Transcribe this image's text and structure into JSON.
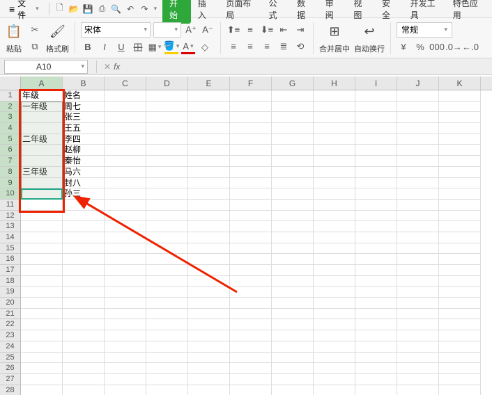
{
  "menu": {
    "file": "文件",
    "tabs": [
      "开始",
      "插入",
      "页面布局",
      "公式",
      "数据",
      "审阅",
      "视图",
      "安全",
      "开发工具",
      "特色应用"
    ],
    "active_tab_index": 0
  },
  "ribbon": {
    "paste": "粘贴",
    "format_painter": "格式刷",
    "font_name": "宋体",
    "font_size": "",
    "merge_center": "合并居中",
    "wrap_text": "自动换行",
    "number_format": "常规"
  },
  "formula": {
    "namebox": "A10",
    "fx": "fx",
    "value": ""
  },
  "columns": [
    "A",
    "B",
    "C",
    "D",
    "E",
    "F",
    "G",
    "H",
    "I",
    "J",
    "K"
  ],
  "row_count": 28,
  "chart_data": {
    "type": "table",
    "columns_visible": [
      "A",
      "B"
    ],
    "headers": {
      "A": "年级",
      "B": "姓名"
    },
    "rows": [
      {
        "A": "一年级",
        "B": "周七"
      },
      {
        "A": "",
        "B": "张三"
      },
      {
        "A": "",
        "B": "王五"
      },
      {
        "A": "二年级",
        "B": "李四"
      },
      {
        "A": "",
        "B": "赵柳"
      },
      {
        "A": "",
        "B": "秦怡"
      },
      {
        "A": "三年级",
        "B": "马六"
      },
      {
        "A": "",
        "B": "封八"
      },
      {
        "A": "",
        "B": "孙三"
      }
    ],
    "selected_range": "A2:A10",
    "active_cell": "A10",
    "annotation": {
      "red_box_around": "A列 (A1:A10)",
      "red_arrow_from": "下方右侧",
      "red_arrow_to": "A10"
    }
  }
}
